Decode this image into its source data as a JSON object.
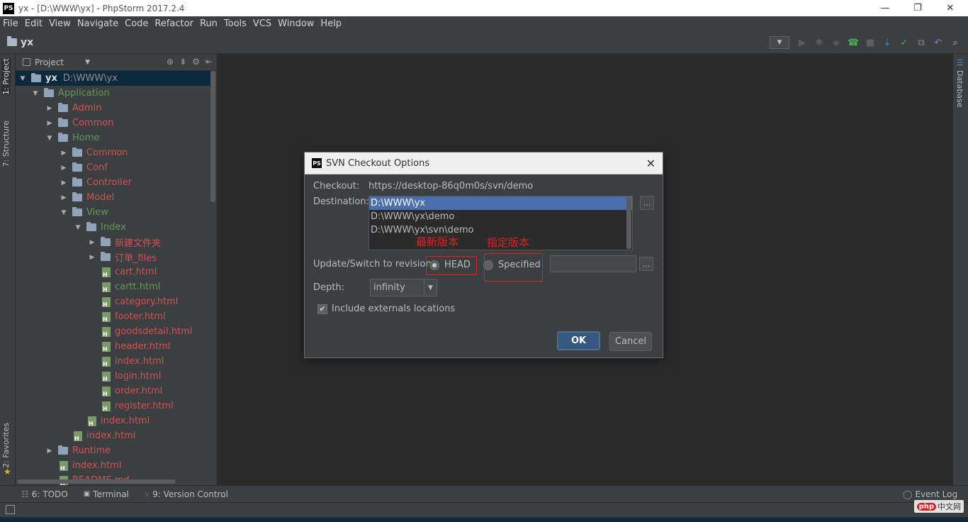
{
  "window": {
    "title": "yx - [D:\\WWW\\yx] - PhpStorm 2017.2.4",
    "logo": "PS",
    "controls": {
      "minimize": "—",
      "maximize": "❐",
      "close": "✕"
    }
  },
  "menu": [
    "File",
    "Edit",
    "View",
    "Navigate",
    "Code",
    "Refactor",
    "Run",
    "Tools",
    "VCS",
    "Window",
    "Help"
  ],
  "toolbar": {
    "breadcrumb": "yx"
  },
  "side_tabs": {
    "project": "1: Project",
    "structure": "7: Structure",
    "favorites": "2: Favorites",
    "database": "Database"
  },
  "project_panel": {
    "header": "Project",
    "tree": [
      {
        "label": "yx",
        "path": "D:\\WWW\\yx",
        "kind": "root"
      },
      {
        "label": "Application",
        "kind": "folder",
        "color": "green"
      },
      {
        "label": "Admin",
        "kind": "folder",
        "color": "red"
      },
      {
        "label": "Common",
        "kind": "folder",
        "color": "red"
      },
      {
        "label": "Home",
        "kind": "folder",
        "color": "green"
      },
      {
        "label": "Common",
        "kind": "folder",
        "color": "red"
      },
      {
        "label": "Conf",
        "kind": "folder",
        "color": "red"
      },
      {
        "label": "Controller",
        "kind": "folder",
        "color": "red"
      },
      {
        "label": "Model",
        "kind": "folder",
        "color": "red"
      },
      {
        "label": "View",
        "kind": "folder",
        "color": "green"
      },
      {
        "label": "Index",
        "kind": "folder",
        "color": "green"
      },
      {
        "label": "新建文件夹",
        "kind": "folder",
        "color": "red"
      },
      {
        "label": "订单_files",
        "kind": "folder",
        "color": "red"
      },
      {
        "label": "cart.html",
        "kind": "file",
        "color": "red"
      },
      {
        "label": "cartt.html",
        "kind": "file",
        "color": "green"
      },
      {
        "label": "category.html",
        "kind": "file",
        "color": "red"
      },
      {
        "label": "footer.html",
        "kind": "file",
        "color": "red"
      },
      {
        "label": "goodsdetail.html",
        "kind": "file",
        "color": "red"
      },
      {
        "label": "header.html",
        "kind": "file",
        "color": "red"
      },
      {
        "label": "index.html",
        "kind": "file",
        "color": "red"
      },
      {
        "label": "login.html",
        "kind": "file",
        "color": "red"
      },
      {
        "label": "order.html",
        "kind": "file",
        "color": "red"
      },
      {
        "label": "register.html",
        "kind": "file",
        "color": "red"
      },
      {
        "label": "index.html",
        "kind": "file",
        "color": "red"
      },
      {
        "label": "index.html",
        "kind": "file",
        "color": "red"
      },
      {
        "label": "Runtime",
        "kind": "folder",
        "color": "red"
      },
      {
        "label": "index.html",
        "kind": "file",
        "color": "red"
      },
      {
        "label": "README.md",
        "kind": "file",
        "color": "red"
      }
    ]
  },
  "dialog": {
    "title": "SVN Checkout Options",
    "logo": "PS",
    "checkout_label": "Checkout:",
    "checkout_url": "https://desktop-86q0m0s/svn/demo",
    "destination_label": "Destination:",
    "destinations": [
      "D:\\WWW\\yx",
      "D:\\WWW\\yx\\demo",
      "D:\\WWW\\yx\\svn\\demo"
    ],
    "selected_destination": "D:\\WWW\\yx",
    "ellipsis": "...",
    "revision_label": "Update/Switch to revision:",
    "head_label": "HEAD",
    "specified_label": "Specified",
    "revision_selected": "HEAD",
    "depth_label": "Depth:",
    "depth_value": "infinity",
    "externals_label": "Include externals locations",
    "externals_checked": true,
    "ok_label": "OK",
    "cancel_label": "Cancel"
  },
  "annotations": {
    "head_note": "最新版本",
    "specified_note": "指定版本"
  },
  "bottom_tabs": [
    {
      "label": "6: TODO"
    },
    {
      "label": "Terminal"
    },
    {
      "label": "9: Version Control"
    }
  ],
  "event_log": "Event Log",
  "watermark": {
    "logo": "php",
    "text": "中文网"
  },
  "colors": {
    "accent": "#4b6eaf",
    "annotation": "#e02020",
    "vcs_modified": "#d25252",
    "vcs_added": "#629755"
  }
}
